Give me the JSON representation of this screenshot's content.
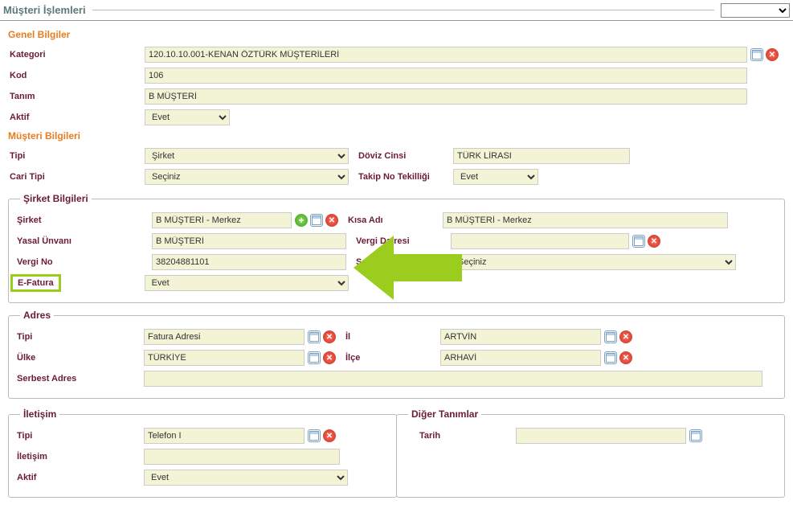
{
  "header": {
    "title": "Müşteri İşlemleri"
  },
  "genel": {
    "title": "Genel Bilgiler",
    "kategori_label": "Kategori",
    "kategori": "120.10.10.001-KENAN ÖZTÜRK MÜŞTERİLERİ",
    "kod_label": "Kod",
    "kod": "106",
    "tanim_label": "Tanım",
    "tanim": "B MÜŞTERİ",
    "aktif_label": "Aktif",
    "aktif": "Evet"
  },
  "musteri": {
    "title": "Müşteri Bilgileri",
    "tipi_label": "Tipi",
    "tipi": "Şirket",
    "doviz_label": "Döviz Cinsi",
    "doviz": "TÜRK LİRASI",
    "cari_label": "Cari Tipi",
    "cari": "Seçiniz",
    "takip_label": "Takip No Tekilliği",
    "takip": "Evet"
  },
  "sirket": {
    "legend": "Şirket Bilgileri",
    "sirket_label": "Şirket",
    "sirket": "B MÜŞTERİ - Merkez",
    "kisa_label": "Kısa Adı",
    "kisa": "B MÜŞTERİ - Merkez",
    "yasal_label": "Yasal Ünvanı",
    "yasal": "B MÜŞTERİ",
    "vd_label": "Vergi Dairesi",
    "vd": "",
    "vergino_label": "Vergi No",
    "vergino": "38204881101",
    "sektor_label": "Sektör",
    "sektor": "Seçiniz",
    "efatura_label": "E-Fatura",
    "efatura": "Evet"
  },
  "adres": {
    "legend": "Adres",
    "tipi_label": "Tipi",
    "tipi": "Fatura Adresi",
    "il_label": "İl",
    "il": "ARTVİN",
    "ulke_label": "Ülke",
    "ulke": "TÜRKİYE",
    "ilce_label": "İlçe",
    "ilce": "ARHAVİ",
    "serbest_label": "Serbest Adres",
    "serbest": ""
  },
  "iletisim": {
    "legend": "İletişim",
    "tipi_label": "Tipi",
    "tipi": "Telefon I",
    "iletisim_label": "İletişim",
    "iletisim": "",
    "aktif_label": "Aktif",
    "aktif": "Evet"
  },
  "diger": {
    "legend": "Diğer Tanımlar",
    "tarih_label": "Tarih",
    "tarih": ""
  }
}
